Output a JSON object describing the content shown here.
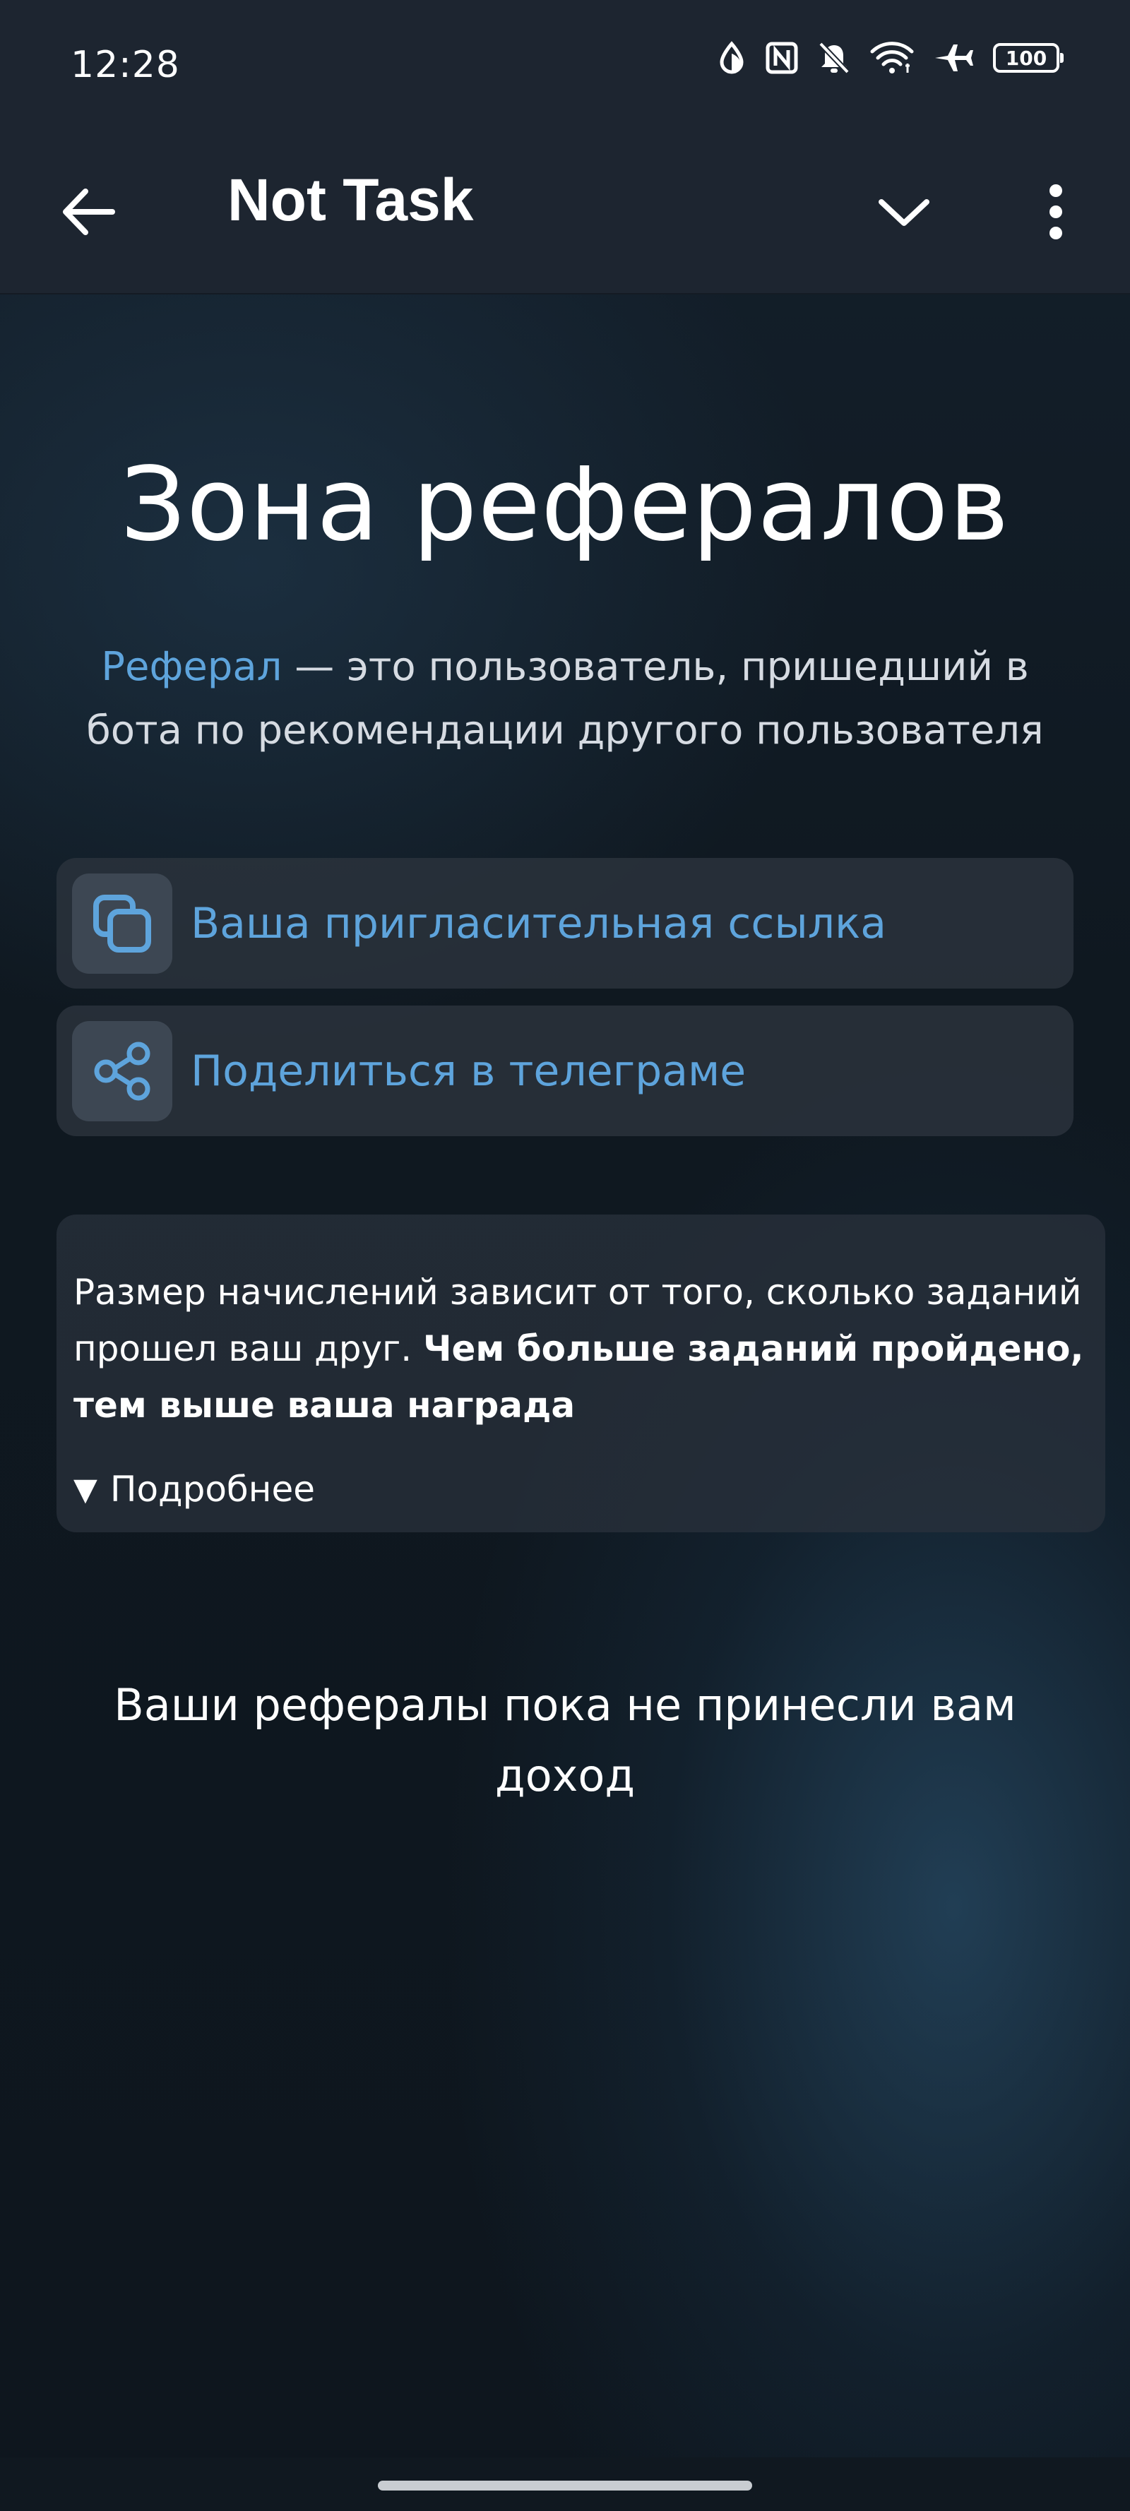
{
  "status_bar": {
    "time": "12:28",
    "battery": "100",
    "icons": [
      "data-saver-icon",
      "nfc-icon",
      "bell-off-icon",
      "wifi-icon",
      "airplane-icon",
      "battery-icon"
    ]
  },
  "app_bar": {
    "title": "Not Task",
    "icons": [
      "back-arrow-icon",
      "chevron-down-icon",
      "more-vertical-icon"
    ]
  },
  "main": {
    "title": "Зона рефералов",
    "intro_accent": "Реферал",
    "intro_rest": " — это пользователь, пришедший в бота по рекомендации другого пользователя",
    "actions": [
      {
        "label": "Ваша пригласительная ссылка",
        "icon": "copy-icon"
      },
      {
        "label": "Поделиться в телеграме",
        "icon": "share-icon"
      }
    ],
    "info": {
      "text": "Размер начислений зависит от того, сколько заданий прошел ваш друг. ",
      "bold": "Чем больше заданий пройдено, тем выше ваша награда",
      "details_marker": "▼",
      "details_label": "Подробнее"
    },
    "empty_message": "Ваши рефералы пока не принесли вам доход"
  },
  "colors": {
    "accent": "#5ea4dc",
    "bar_background": "#1d2530",
    "card_background": "#2a323c"
  }
}
